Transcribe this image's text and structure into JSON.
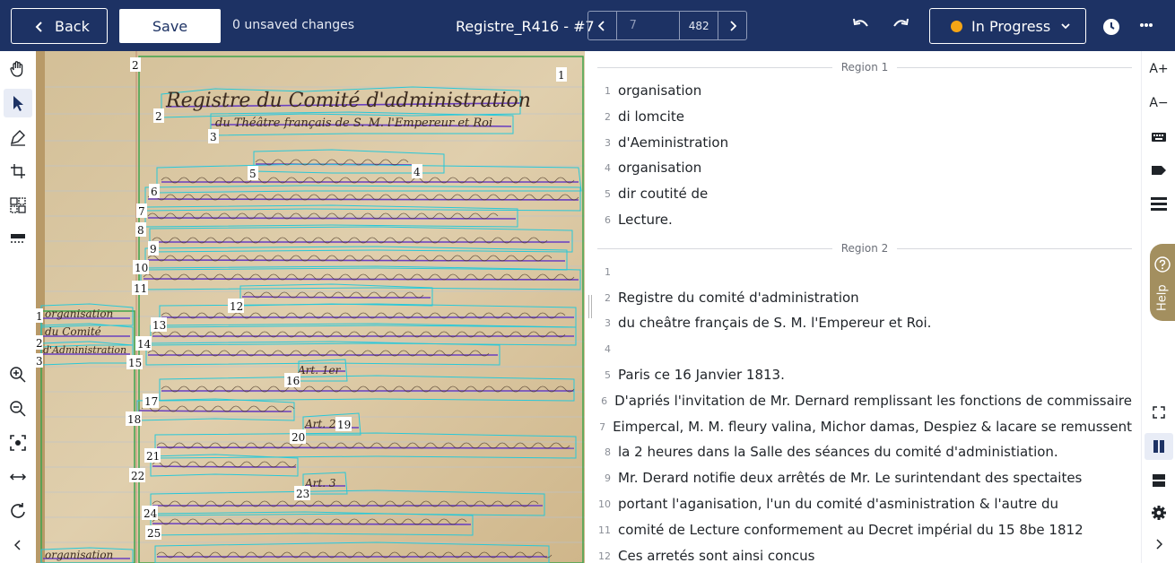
{
  "header": {
    "back_label": "Back",
    "save_label": "Save",
    "unsaved_text": "0 unsaved changes",
    "doc_title": "Registre_R416 - #7",
    "page_input": "7",
    "page_total": "482",
    "status_label": "In Progress",
    "status_color": "#f5a516",
    "bg_color": "#1d3264"
  },
  "image": {
    "title_line1": "Registre du Comité d'administration",
    "title_line2": "du Théâtre français de S. M. l'Empereur et Roi",
    "margin_lines": [
      "organisation",
      "du Comité",
      "d'Administration"
    ],
    "margin_lines_2": [
      "organisation"
    ],
    "heading_art1": "Art. 1er",
    "heading_art2": "Art. 2",
    "heading_art3": "Art. 3",
    "region_labels": [
      "2",
      "1",
      "2",
      "3",
      "4",
      "5",
      "6",
      "7",
      "8",
      "9",
      "10",
      "11",
      "12",
      "13",
      "14",
      "15",
      "16",
      "17",
      "18",
      "19",
      "20",
      "21",
      "22",
      "23",
      "24",
      "25"
    ],
    "margin_labels": [
      "1",
      "2",
      "3"
    ]
  },
  "regions": [
    {
      "label": "Region 1",
      "lines": [
        {
          "n": "1",
          "text": "organisation"
        },
        {
          "n": "2",
          "text": "di lomcite"
        },
        {
          "n": "3",
          "text": "d'Aeministration"
        },
        {
          "n": "4",
          "text": "organisation"
        },
        {
          "n": "5",
          "text": "dir coutité de"
        },
        {
          "n": "6",
          "text": "Lecture."
        }
      ]
    },
    {
      "label": "Region 2",
      "lines": [
        {
          "n": "1",
          "text": ""
        },
        {
          "n": "2",
          "text": "Registre du comité d'administration"
        },
        {
          "n": "3",
          "text": "du cheâtre français de S. M. l'Empereur et Roi."
        },
        {
          "n": "4",
          "text": ""
        },
        {
          "n": "5",
          "text": "Paris ce 16 Janvier 1813."
        },
        {
          "n": "6",
          "text": "D'apriés l'invitation de Mr. Dernard remplissant les fonctions de commissaire"
        },
        {
          "n": "7",
          "text": "Eimpercal, M. M. fleury valina, Michor damas, Despiez & lacare se remussent"
        },
        {
          "n": "8",
          "text": "la 2 heures dans la Salle des séances du comité d'administiation."
        },
        {
          "n": "9",
          "text": "Mr. Derard notifie deux arrêtés de Mr. Le surintendant des spectaites"
        },
        {
          "n": "10",
          "text": "portant l'aganisation, l'un du comité d'asministration & l'autre du"
        },
        {
          "n": "11",
          "text": "comité de Lecture conformement au Decret impérial du 15 8be 1812"
        },
        {
          "n": "12",
          "text": "Ces arretés sont ainsi concus"
        }
      ]
    }
  ],
  "help_label": "Help",
  "right_tools": [
    "A+",
    "A−"
  ]
}
